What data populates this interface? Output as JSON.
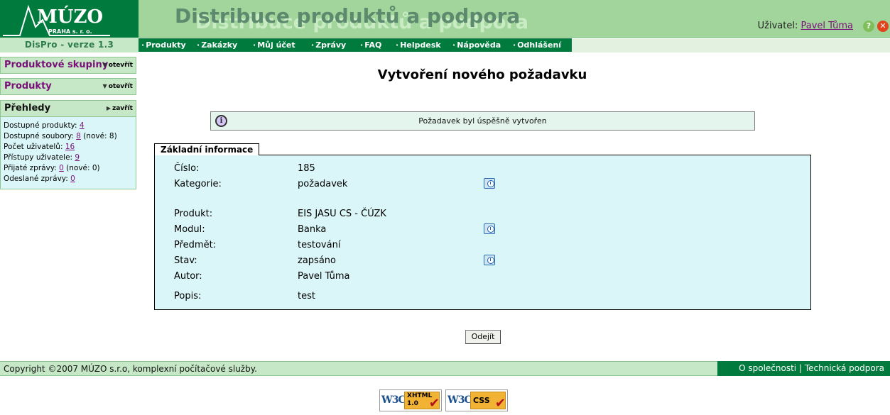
{
  "header": {
    "logo_text": "MÚZO",
    "logo_sub": "PRAHA s. r. o.",
    "version": "DisPro - verze 1.3",
    "site_title": "Distribuce produktů a podpora",
    "user_label": "Uživatel:",
    "user_name": "Pavel Tůma",
    "help_icon": "?",
    "close_icon": "✕"
  },
  "nav": {
    "items": [
      {
        "label": "Produkty"
      },
      {
        "label": "Zakázky"
      },
      {
        "label": "Můj účet"
      },
      {
        "label": "Zprávy"
      },
      {
        "label": "FAQ"
      },
      {
        "label": "Helpdesk"
      },
      {
        "label": "Nápověda"
      },
      {
        "label": "Odhlášení"
      }
    ]
  },
  "sidebar": {
    "groups": [
      {
        "title": "Produktové skupiny",
        "action": "otevřít"
      },
      {
        "title": "Produkty",
        "action": "otevřít"
      },
      {
        "title": "Přehledy",
        "action": "zavřít"
      }
    ],
    "stats": [
      {
        "label": "Dostupné produkty:",
        "value": "4",
        "extra": ""
      },
      {
        "label": "Dostupné soubory:",
        "value": "8",
        "extra": "(nové: 8)"
      },
      {
        "label": "Počet uživatelů:",
        "value": "16",
        "extra": ""
      },
      {
        "label": "Přístupy uživatele:",
        "value": "9",
        "extra": ""
      },
      {
        "label": "Přijaté zprávy:",
        "value": "0",
        "extra": "(nové: 0)"
      },
      {
        "label": "Odeslané zprávy:",
        "value": "0",
        "extra": ""
      }
    ]
  },
  "main": {
    "title": "Vytvoření nového požadavku",
    "message": "Požadavek byl úspěšně vytvořen",
    "info_icon": "i",
    "section_title": "Základní informace",
    "fields": [
      {
        "label": "Číslo:",
        "value": "185"
      },
      {
        "label": "Kategorie:",
        "value": "požadavek"
      },
      {
        "label": "Produkt:",
        "value": "EIS JASU CS - ČÚZK"
      },
      {
        "label": "Modul:",
        "value": "Banka"
      },
      {
        "label": "Předmět:",
        "value": "testování"
      },
      {
        "label": "Stav:",
        "value": "zapsáno"
      },
      {
        "label": "Autor:",
        "value": "Pavel Tůma"
      },
      {
        "label": "Popis:",
        "value": "test"
      }
    ],
    "leave_button": "Odejít"
  },
  "footer": {
    "copyright": "Copyright ©2007 MÚZO s.r.o, komplexní počítačové služby.",
    "about_link": "O společnosti",
    "separator": "|",
    "support_link": "Technická podpora",
    "badge_xhtml_w3c": "W3C",
    "badge_xhtml_label": "XHTML 1.0",
    "badge_css_w3c": "W3C",
    "badge_css_label": "CSS",
    "badge_check": "✔"
  }
}
